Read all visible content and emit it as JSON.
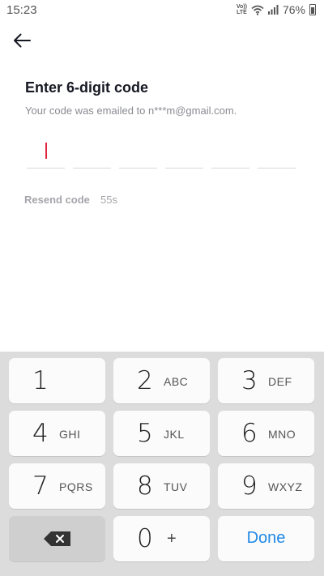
{
  "status_bar": {
    "time": "15:23",
    "volte_line1": "Vo))",
    "volte_line2": "LTE",
    "battery_percent": "76%"
  },
  "header": {
    "back_icon": "arrow-left-icon"
  },
  "main": {
    "title": "Enter 6-digit code",
    "subtitle": "Your code was emailed to n***m@gmail.com.",
    "code_slots": [
      "",
      "",
      "",
      "",
      "",
      ""
    ],
    "resend_label": "Resend code",
    "countdown": "55s"
  },
  "keypad": {
    "keys": [
      {
        "digit": "1",
        "letters": ""
      },
      {
        "digit": "2",
        "letters": "ABC"
      },
      {
        "digit": "3",
        "letters": "DEF"
      },
      {
        "digit": "4",
        "letters": "GHI"
      },
      {
        "digit": "5",
        "letters": "JKL"
      },
      {
        "digit": "6",
        "letters": "MNO"
      },
      {
        "digit": "7",
        "letters": "PQRS"
      },
      {
        "digit": "8",
        "letters": "TUV"
      },
      {
        "digit": "9",
        "letters": "WXYZ"
      }
    ],
    "zero": "0",
    "plus": "+",
    "done": "Done",
    "backspace_icon": "backspace-icon"
  },
  "colors": {
    "cursor": "#e1253f",
    "done": "#1e88e5",
    "muted_text": "#a5a6aa"
  }
}
